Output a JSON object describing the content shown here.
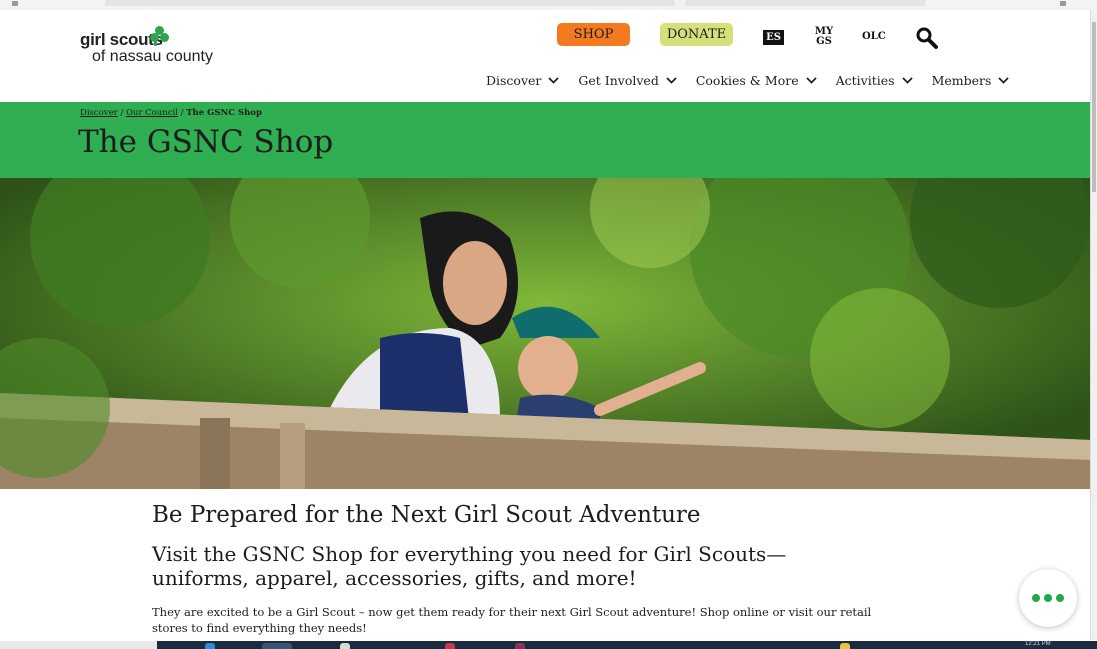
{
  "header": {
    "logo_line1": "girl scouts",
    "logo_line2": "of nassau county",
    "shop_label": "SHOP",
    "donate_label": "DONATE",
    "es_label": "ES",
    "mygs_line1": "MY",
    "mygs_line2": "GS",
    "olc_label": "OLC",
    "search_icon": "search-icon"
  },
  "nav": {
    "items": [
      {
        "label": "Discover"
      },
      {
        "label": "Get Involved"
      },
      {
        "label": "Cookies & More"
      },
      {
        "label": "Activities"
      },
      {
        "label": "Members"
      }
    ]
  },
  "breadcrumb": {
    "items": [
      "Discover",
      "Our Council"
    ],
    "separator": "/",
    "current": "The GSNC Shop"
  },
  "page": {
    "title": "The GSNC Shop"
  },
  "content": {
    "heading": "Be Prepared for the Next Girl Scout Adventure",
    "subheading": "Visit the GSNC Shop for everything you need for Girl Scouts—uniforms, apparel, accessories, gifts, and more!",
    "paragraph": "They are excited to be a Girl Scout – now get them ready for their next Girl Scout adventure! Shop online or visit our retail stores to find everything they needs!"
  },
  "colors": {
    "banner_green": "#2fae52",
    "shop_orange": "#f47a20",
    "donate_lime": "#d6e07a",
    "chat_green": "#1fa84b"
  },
  "taskbar": {
    "clock": "12:21 PM"
  }
}
